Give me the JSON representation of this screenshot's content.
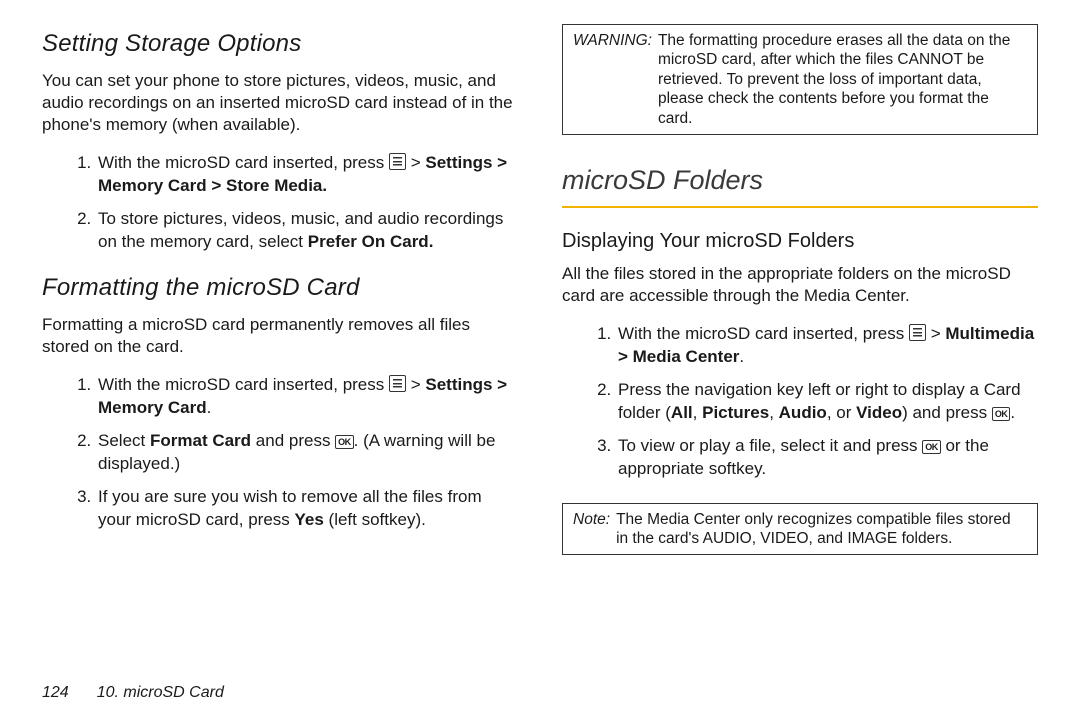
{
  "left": {
    "heading1": "Setting Storage Options",
    "para1": "You can set your phone to store pictures, videos, music, and audio recordings on an inserted microSD card instead of in the phone's memory (when available).",
    "list1": {
      "item1_pre": "With the microSD card inserted, press ",
      "item1_post": " > ",
      "item1_bold": "Settings > Memory Card  > Store Media.",
      "item2_pre": "To store pictures, videos, music, and audio recordings on the memory card, select ",
      "item2_bold": "Prefer On Card."
    },
    "heading2": "Formatting the microSD Card",
    "para2": "Formatting a microSD card permanently removes all files stored on the card.",
    "list2": {
      "item1_pre": "With the microSD card inserted, press ",
      "item1_post": " > ",
      "item1_bold": "Settings > Memory Card",
      "item1_tail": ".",
      "item2_pre": "Select ",
      "item2_bold": "Format Card",
      "item2_mid": " and press ",
      "item2_tail": ". (A warning will be displayed.)",
      "item3_pre": "If you are sure you wish to remove all the files from your microSD card, press ",
      "item3_bold": "Yes",
      "item3_tail": " (left softkey)."
    }
  },
  "right": {
    "warning_label": "WARNING:",
    "warning_text": "The formatting procedure erases all the data on the microSD card, after which the files CANNOT be retrieved. To prevent the loss of important data, please check the contents before you format the card.",
    "section_title": "microSD Folders",
    "subheading": "Displaying Your microSD Folders",
    "para": "All the files stored in the appropriate folders on the microSD card are accessible through the Media Center.",
    "list": {
      "item1_pre": "With the microSD card inserted, press ",
      "item1_post": " > ",
      "item1_bold": "Multimedia > Media Center",
      "item1_tail": ".",
      "item2_pre": "Press the navigation key left or right to display a Card folder (",
      "item2_b1": "All",
      "item2_s1": ", ",
      "item2_b2": "Pictures",
      "item2_s2": ", ",
      "item2_b3": "Audio",
      "item2_s3": ", or ",
      "item2_b4": "Video",
      "item2_mid": ") and press ",
      "item2_tail": ".",
      "item3_pre": "To view or play a file, select it and press ",
      "item3_tail": " or the appropriate softkey."
    },
    "note_label": "Note:",
    "note_text": "The Media Center only recognizes compatible files stored in the card's AUDIO, VIDEO, and IMAGE folders."
  },
  "footer": {
    "page": "124",
    "chapter": "10. microSD Card"
  },
  "icons": {
    "ok": "OK"
  }
}
